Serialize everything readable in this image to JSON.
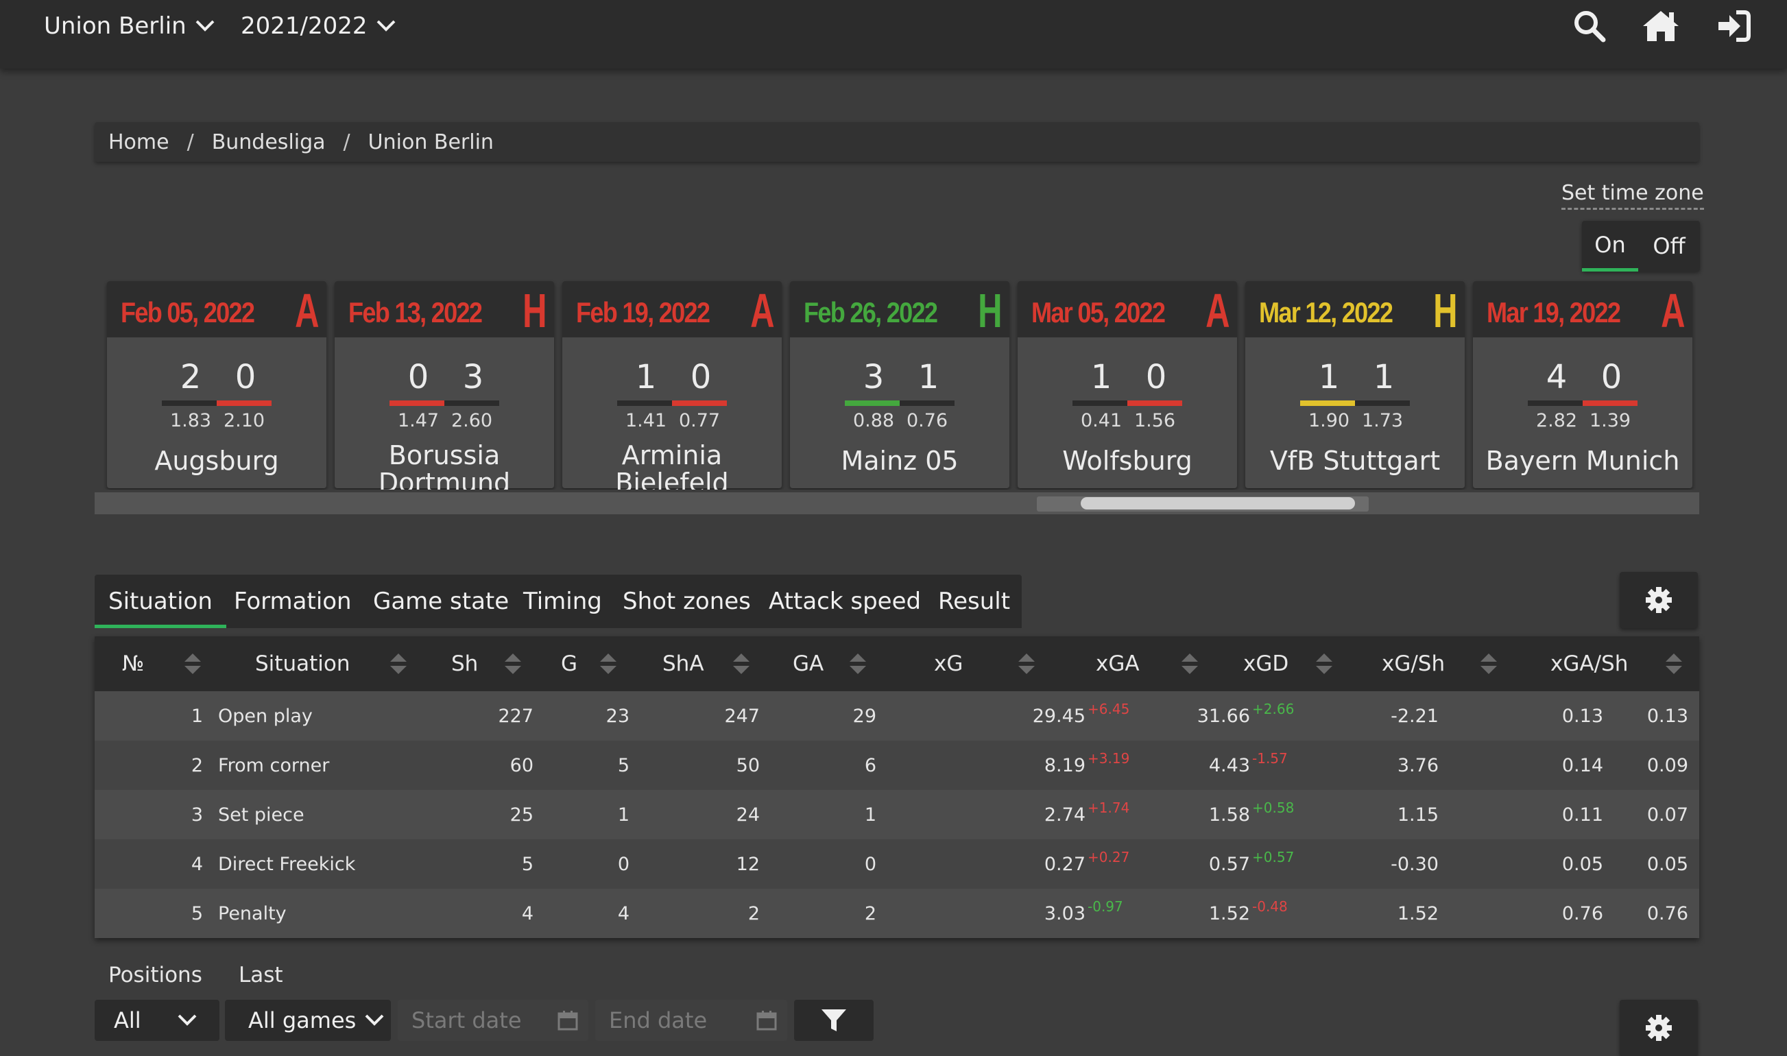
{
  "navbar": {
    "team_select": "Union Berlin",
    "season_select": "2021/2022",
    "icons": [
      "search-icon",
      "home-icon",
      "sign-in-icon"
    ]
  },
  "breadcrumb": [
    "Home",
    "Bundesliga",
    "Union Berlin"
  ],
  "timezone": {
    "label": "Set time zone",
    "on": "On",
    "off": "Off",
    "selected": "On"
  },
  "colors": {
    "loss": "#d8392f",
    "win": "#44a83e",
    "draw": "#e2c22c",
    "accent": "#2fb35a"
  },
  "matches": [
    {
      "date": "Feb 05, 2022",
      "venue": "A",
      "result": "loss",
      "score_home": "2",
      "score_away": "0",
      "xg_home": "1.83",
      "xg_away": "2.10",
      "opponent": "Augsburg",
      "win_side": "away"
    },
    {
      "date": "Feb 13, 2022",
      "venue": "H",
      "result": "loss",
      "score_home": "0",
      "score_away": "3",
      "xg_home": "1.47",
      "xg_away": "2.60",
      "opponent": "Borussia Dortmund",
      "win_side": "home"
    },
    {
      "date": "Feb 19, 2022",
      "venue": "A",
      "result": "loss",
      "score_home": "1",
      "score_away": "0",
      "xg_home": "1.41",
      "xg_away": "0.77",
      "opponent": "Arminia Bielefeld",
      "win_side": "away"
    },
    {
      "date": "Feb 26, 2022",
      "venue": "H",
      "result": "win",
      "score_home": "3",
      "score_away": "1",
      "xg_home": "0.88",
      "xg_away": "0.76",
      "opponent": "Mainz 05",
      "win_side": "home"
    },
    {
      "date": "Mar 05, 2022",
      "venue": "A",
      "result": "loss",
      "score_home": "1",
      "score_away": "0",
      "xg_home": "0.41",
      "xg_away": "1.56",
      "opponent": "Wolfsburg",
      "win_side": "away"
    },
    {
      "date": "Mar 12, 2022",
      "venue": "H",
      "result": "draw",
      "score_home": "1",
      "score_away": "1",
      "xg_home": "1.90",
      "xg_away": "1.73",
      "opponent": "VfB Stuttgart",
      "win_side": "home"
    },
    {
      "date": "Mar 19, 2022",
      "venue": "A",
      "result": "loss",
      "score_home": "4",
      "score_away": "0",
      "xg_home": "2.82",
      "xg_away": "1.39",
      "opponent": "Bayern Munich",
      "win_side": "away"
    }
  ],
  "tabs": [
    "Situation",
    "Formation",
    "Game state",
    "Timing",
    "Shot zones",
    "Attack speed",
    "Result"
  ],
  "active_tab": "Situation",
  "table": {
    "headers": [
      "№",
      "Situation",
      "Sh",
      "G",
      "ShA",
      "GA",
      "xG",
      "xGA",
      "xGD",
      "xG/Sh",
      "xGA/Sh"
    ],
    "rows": [
      {
        "n": "1",
        "situation": "Open play",
        "sh": "227",
        "g": "23",
        "sha": "247",
        "ga": "29",
        "xg": "29.45",
        "xg_d": "+6.45",
        "xg_dc": "pos",
        "xga": "31.66",
        "xga_d": "+2.66",
        "xga_dc": "neg",
        "xgd": "-2.21",
        "xgsh": "0.13",
        "xgash": "0.13"
      },
      {
        "n": "2",
        "situation": "From corner",
        "sh": "60",
        "g": "5",
        "sha": "50",
        "ga": "6",
        "xg": "8.19",
        "xg_d": "+3.19",
        "xg_dc": "pos",
        "xga": "4.43",
        "xga_d": "-1.57",
        "xga_dc": "pos",
        "xgd": "3.76",
        "xgsh": "0.14",
        "xgash": "0.09"
      },
      {
        "n": "3",
        "situation": "Set piece",
        "sh": "25",
        "g": "1",
        "sha": "24",
        "ga": "1",
        "xg": "2.74",
        "xg_d": "+1.74",
        "xg_dc": "pos",
        "xga": "1.58",
        "xga_d": "+0.58",
        "xga_dc": "neg",
        "xgd": "1.15",
        "xgsh": "0.11",
        "xgash": "0.07"
      },
      {
        "n": "4",
        "situation": "Direct Freekick",
        "sh": "5",
        "g": "0",
        "sha": "12",
        "ga": "0",
        "xg": "0.27",
        "xg_d": "+0.27",
        "xg_dc": "pos",
        "xga": "0.57",
        "xga_d": "+0.57",
        "xga_dc": "neg",
        "xgd": "-0.30",
        "xgsh": "0.05",
        "xgash": "0.05"
      },
      {
        "n": "5",
        "situation": "Penalty",
        "sh": "4",
        "g": "4",
        "sha": "2",
        "ga": "2",
        "xg": "3.03",
        "xg_d": "-0.97",
        "xg_dc": "neg",
        "xga": "1.52",
        "xga_d": "-0.48",
        "xga_dc": "pos",
        "xgd": "1.52",
        "xgsh": "0.76",
        "xgash": "0.76"
      }
    ]
  },
  "bottom": {
    "tabs": [
      "Positions",
      "Last"
    ],
    "position_select": "All",
    "games_select": "All games",
    "start_date_placeholder": "Start date",
    "end_date_placeholder": "End date"
  }
}
